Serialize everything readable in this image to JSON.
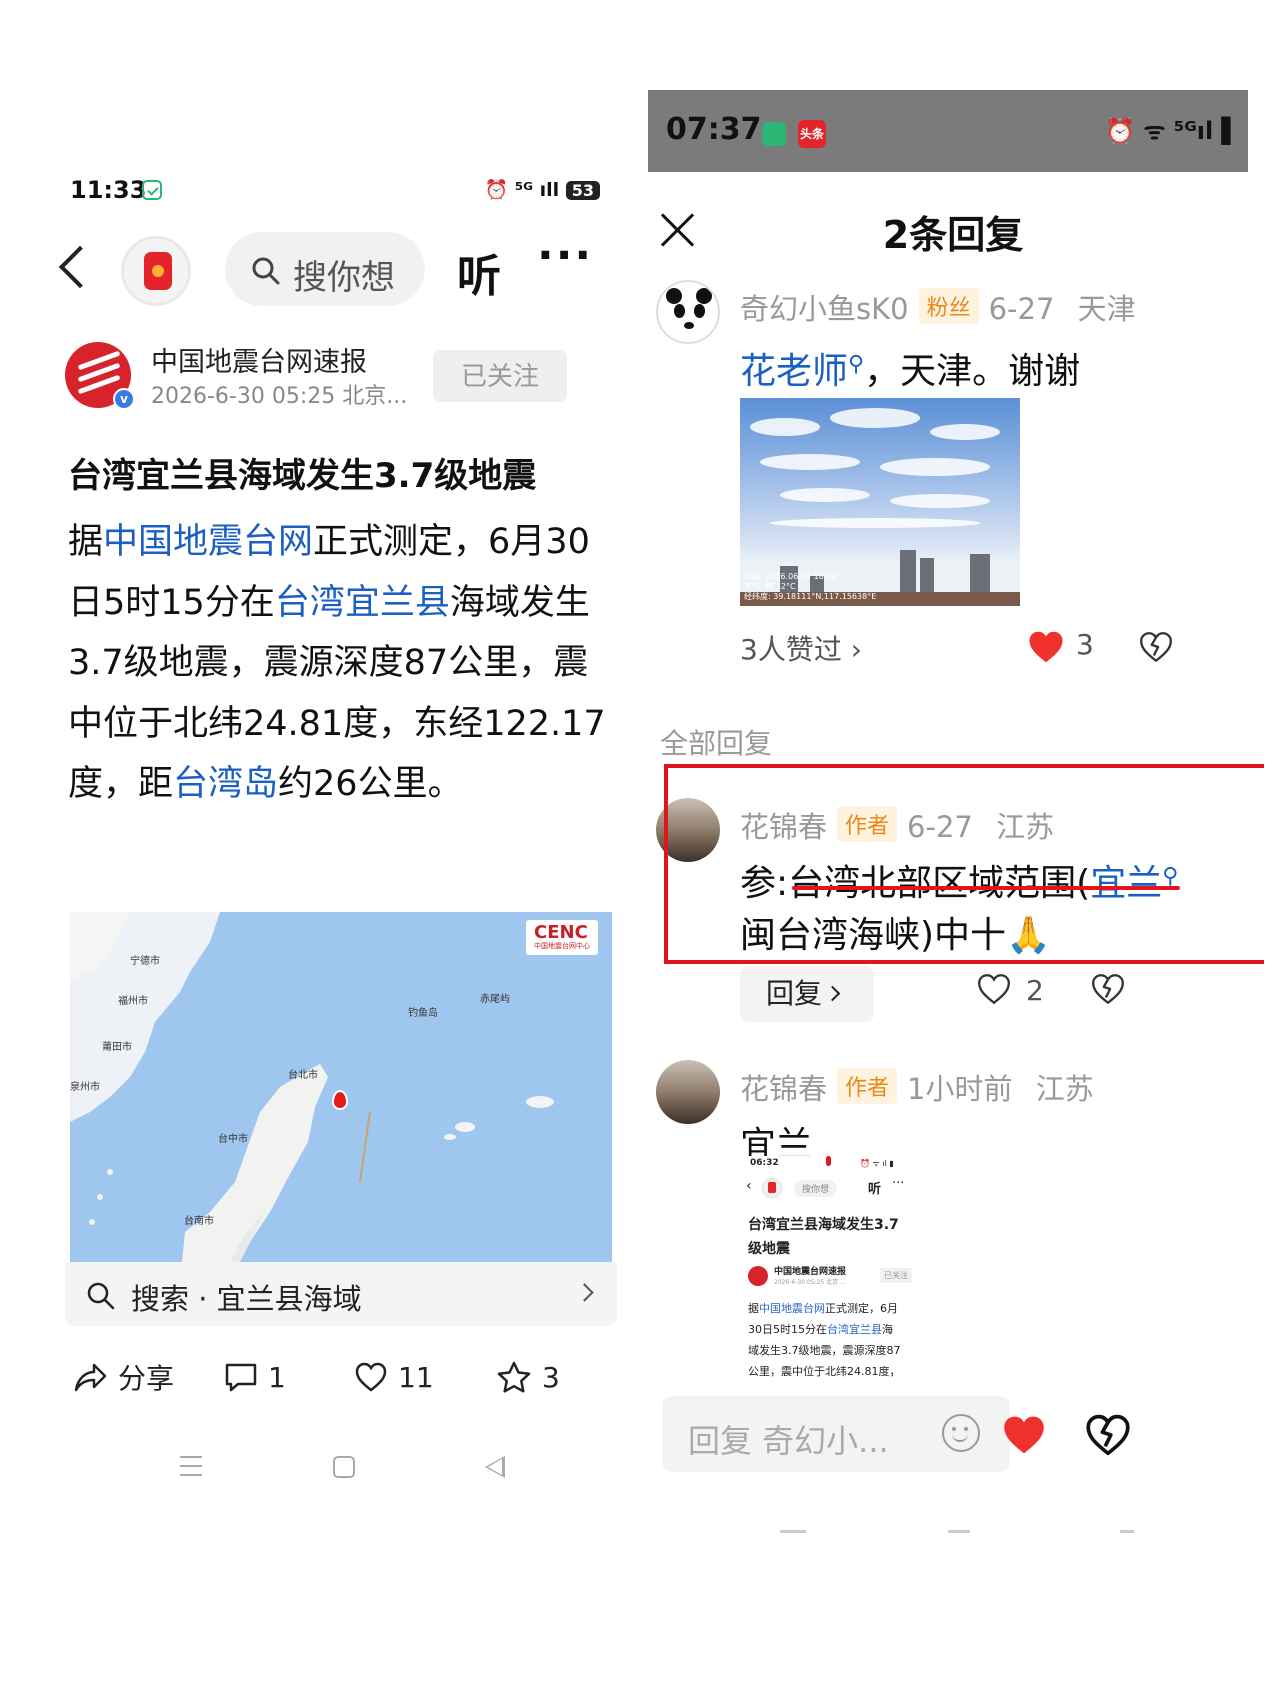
{
  "left": {
    "status": {
      "time": "11:33",
      "signal_text": "⏰ ⁵ᴳ⺒ıl",
      "battery": "53"
    },
    "nav": {
      "search_placeholder": "搜你想",
      "listen_label": "听",
      "more_label": "···"
    },
    "author": {
      "name": "中国地震台网速报",
      "meta": "2026-6-30 05:25 北京...",
      "follow_label": "已关注",
      "verified_mark": "v"
    },
    "article": {
      "title": "台湾宜兰县海域发生3.7级地震",
      "body": [
        {
          "text": "据",
          "link": false
        },
        {
          "text": "中国地震台网",
          "link": true
        },
        {
          "text": "正式测定，6月30日5时15分在",
          "link": false
        },
        {
          "text": "台湾宜兰县",
          "link": true
        },
        {
          "text": "海域发生3.7级地震，震源深度87公里，震中位于北纬24.81度，东经122.17度，距",
          "link": false
        },
        {
          "text": "台湾岛",
          "link": true
        },
        {
          "text": "约26公里。",
          "link": false
        }
      ]
    },
    "map": {
      "badge_title": "CENC",
      "badge_subtitle": "中国地震台网中心",
      "cities": [
        "宁德市",
        "福州市",
        "莆田市",
        "泉州市",
        "钓鱼岛",
        "赤尾屿",
        "台北市",
        "台中市",
        "台南市"
      ]
    },
    "map_search": {
      "text": "搜索 · 宜兰县海域"
    },
    "actions": {
      "share_label": "分享",
      "comment_count": "1",
      "like_count": "11",
      "favorite_count": "3"
    }
  },
  "right": {
    "status": {
      "time": "07:37",
      "app_label": "头条",
      "signal_text": "⏰ ᯤ ⁵ᴳıl ▌"
    },
    "header": {
      "title": "2条回复"
    },
    "main_comment": {
      "user": "奇幻小鱼sK0",
      "badge": "粉丝",
      "date": "6-27",
      "location": "天津",
      "mention": "花老师",
      "text": "，天津。谢谢",
      "photo_stamp": [
        "时间: 2026.06.27 18:32",
        "天气: 晴 32°C",
        "经纬度: 39.18111°N,117.15638°E"
      ],
      "likes_text": "3人赞过",
      "like_count": "3"
    },
    "all_replies_label": "全部回复",
    "reply1": {
      "user": "花锦春",
      "badge": "作者",
      "date": "6-27",
      "location": "江苏",
      "text_prefix": "参:台湾北部区域范围(",
      "link": "宜兰",
      "text_line2": "闽台湾海峡)中十🙏",
      "reply_label": "回复",
      "like_count": "2"
    },
    "reply2": {
      "user": "花锦春",
      "badge": "作者",
      "date": "1小时前",
      "location": "江苏",
      "text": "宜兰",
      "shot": {
        "time": "06:32",
        "search": "搜你想",
        "listen": "听",
        "title1": "台湾宜兰县海域发生3.7",
        "title2": "级地震",
        "author": "中国地震台网速报",
        "follow": "已关注",
        "meta": "2026-6-30 05:25 北京 ...",
        "line1a": "据",
        "line1b": "中国地震台网",
        "line1c": "正式测定，6月",
        "line2a": "30日5时15分在",
        "line2b": "台湾宜兰县",
        "line2c": "海",
        "line3": "域发生3.7级地震，震源深度87",
        "line4": "公里，震中位于北纬24.81度，"
      }
    },
    "input": {
      "placeholder": "回复 奇幻小..."
    }
  }
}
